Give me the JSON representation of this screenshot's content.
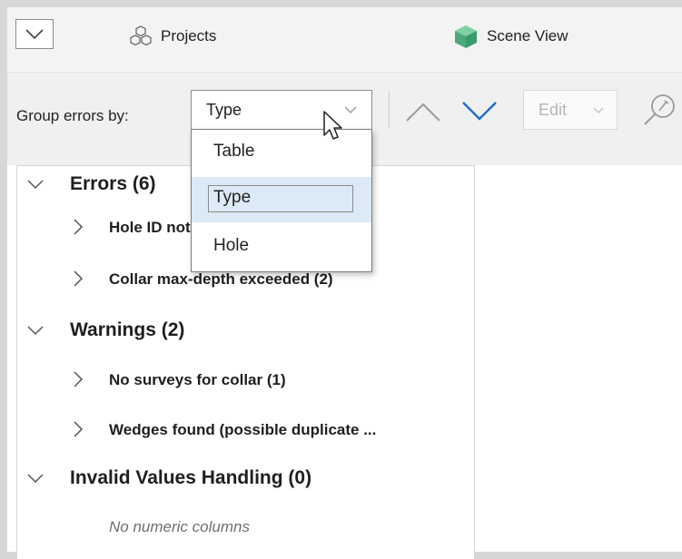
{
  "topbar": {
    "tabs": [
      {
        "label": "Projects",
        "icon": "projects-icon"
      },
      {
        "label": "Scene View",
        "icon": "scene-cube-icon",
        "icon_color": "#5bb58a"
      }
    ]
  },
  "toolbar": {
    "group_label": "Group errors by:",
    "group_select": {
      "value": "Type",
      "options": [
        "Table",
        "Type",
        "Hole"
      ],
      "highlighted": "Type"
    },
    "edit_label": "Edit"
  },
  "tree": {
    "groups": [
      {
        "label": "Errors (6)",
        "expanded": true,
        "items": [
          "Hole ID not found in collar (4)",
          "Collar max-depth exceeded (2)"
        ]
      },
      {
        "label": "Warnings (2)",
        "expanded": true,
        "items": [
          "No surveys for collar (1)",
          "Wedges found (possible duplicate ..."
        ]
      },
      {
        "label": "Invalid Values Handling (0)",
        "expanded": true,
        "placeholder": "No numeric columns"
      }
    ]
  },
  "colors": {
    "accent": "#1e6bd0",
    "selection": "#dce9f6"
  }
}
